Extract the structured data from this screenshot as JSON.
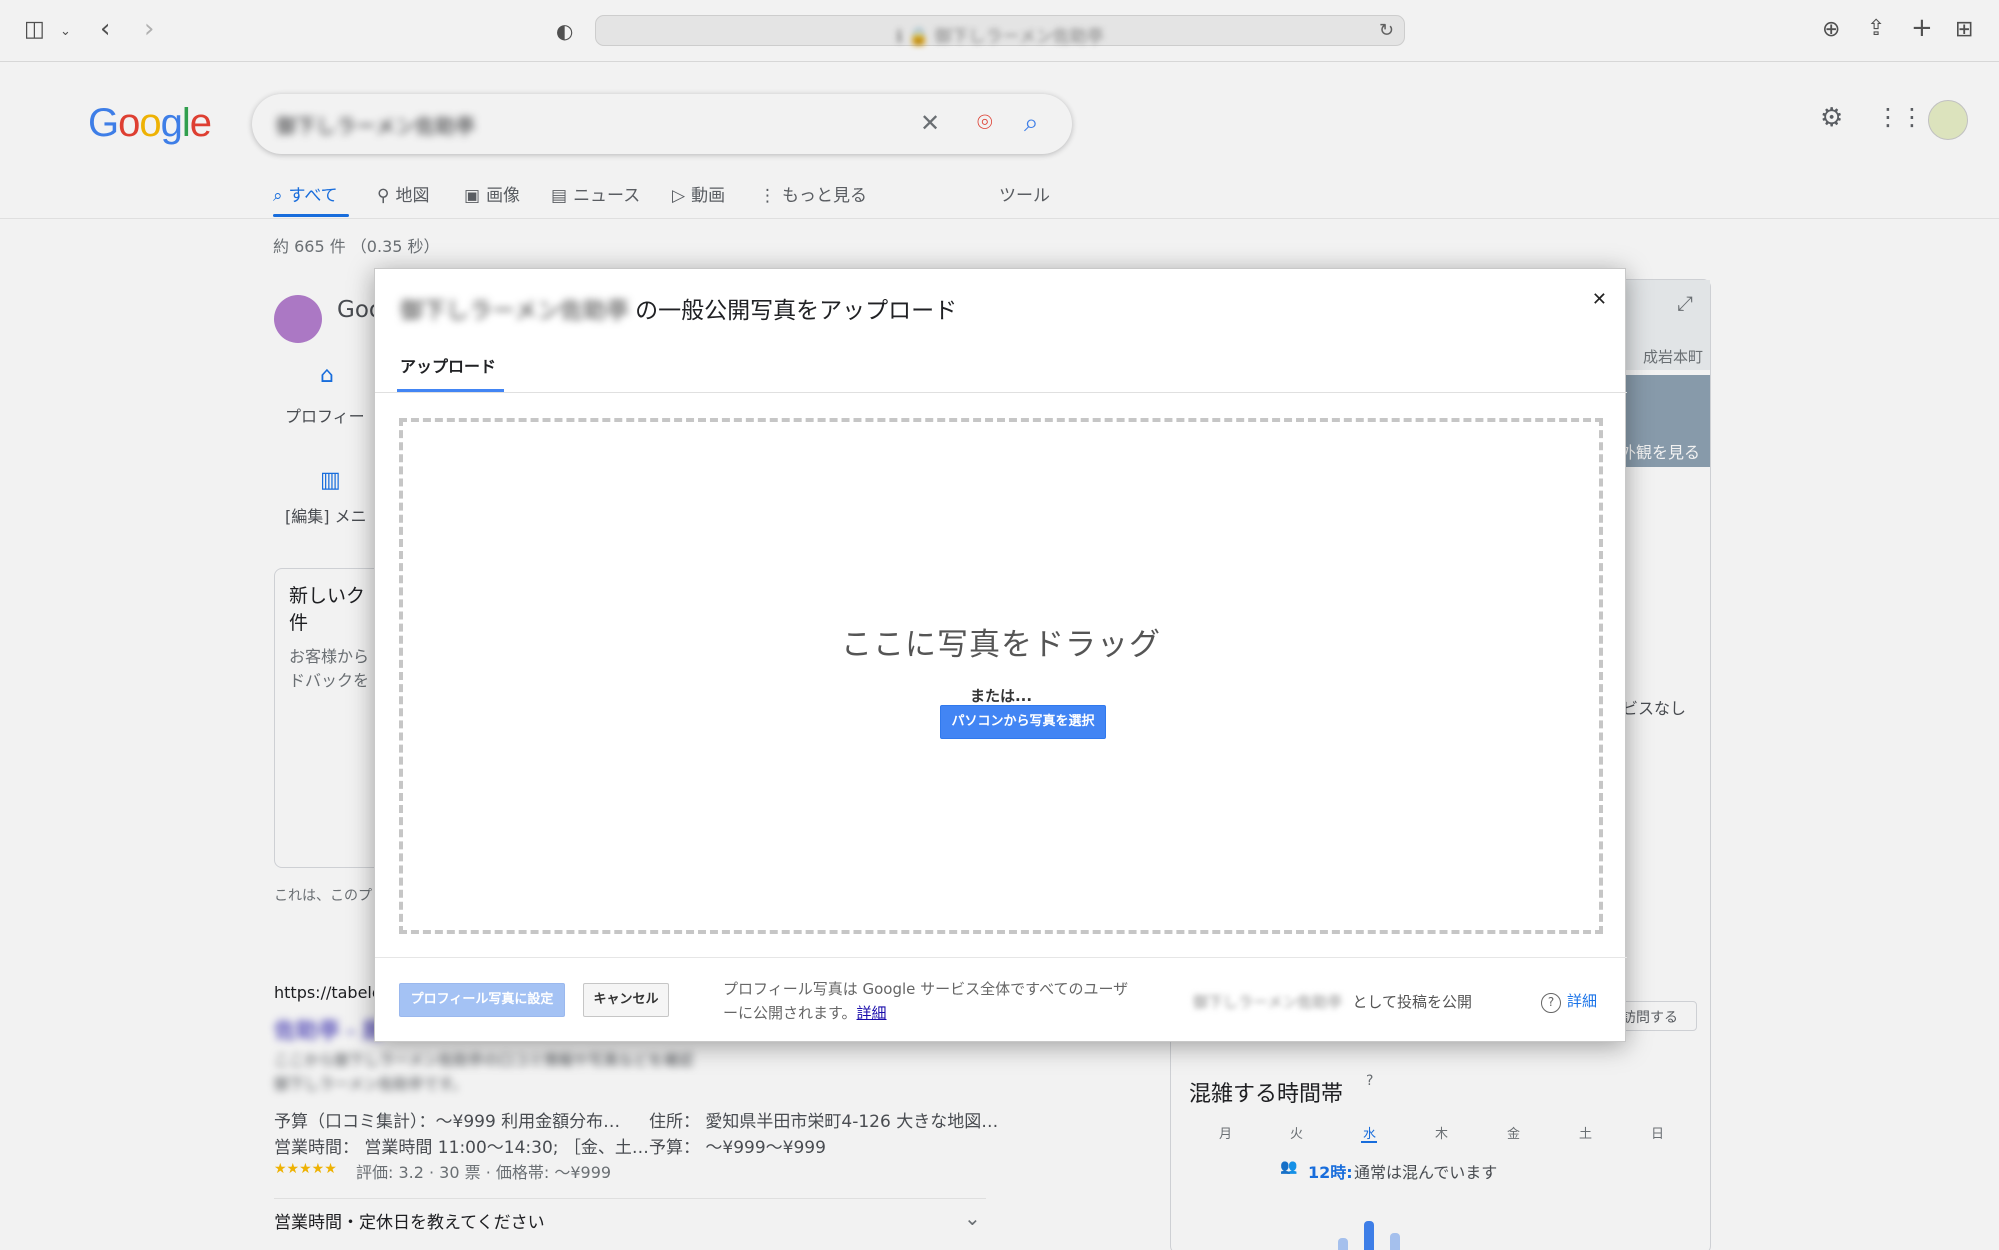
{
  "browser": {
    "url": "ℹ︎ 🔒 御下しラーメン佐助亭",
    "icons": [
      "sidebar-icon",
      "chevron-down-icon",
      "back-icon",
      "forward-icon",
      "shield-icon",
      "reload-icon",
      "download-icon",
      "share-icon",
      "plus-icon",
      "tabs-grid-icon"
    ]
  },
  "google": {
    "logo": [
      "G",
      "o",
      "o",
      "g",
      "l",
      "e"
    ],
    "logo_colors": [
      "#4285f4",
      "#ea4335",
      "#fbbc05",
      "#4285f4",
      "#34a853",
      "#ea4335"
    ],
    "query": "御下しラーメン佐助亭",
    "tabs": [
      {
        "label": "すべて",
        "icon": "search-icon"
      },
      {
        "label": "地図",
        "icon": "map-pin-icon"
      },
      {
        "label": "画像",
        "icon": "image-icon"
      },
      {
        "label": "ニュース",
        "icon": "news-icon"
      },
      {
        "label": "動画",
        "icon": "video-icon"
      },
      {
        "label": "もっと見る",
        "icon": "more-vert-icon"
      },
      {
        "label": "ツール",
        "icon": ""
      }
    ],
    "result_stats": "約 665 件 （0.35 秒）"
  },
  "background": {
    "goo": "Goo",
    "profile": "プロフィー",
    "menu_edit": "[編集] メニ",
    "new_card_1": "新しいク",
    "new_card_2": "件",
    "customer_1": "お客様から",
    "customer_2": "ドバックを",
    "this_is": "これは、このプ",
    "tabelog_url": "https://tabelog",
    "budget_line": "予算（口コミ集計）：～¥999 利用金額分布…",
    "address_line": "住所： 愛知県半田市栄町4-126 大きな地図…",
    "hours_line": "営業時間： 営業時間 11:00～14:30; ［金、土…",
    "budget2_line": "予算： ～¥999～¥999",
    "rating_line": "評価: 3.2 · 30 票 · 価格帯: ～¥999",
    "stars": "★★★★★",
    "hours_ask": "営業時間・定休日を教えてください",
    "map_label": "成岩本町",
    "exterior": "外観を見る",
    "service_none": "ビスなし",
    "visit": "訪問する",
    "busy_title": "混雑する時間帯",
    "days": [
      "月",
      "火",
      "水",
      "木",
      "金",
      "土",
      "日"
    ],
    "busy_now": "12時:",
    "busy_text": "通常は混んでいます"
  },
  "modal": {
    "place_name": "御下しラーメン佐助亭",
    "title_suffix": "の一般公開写真をアップロード",
    "tab_upload": "アップロード",
    "drop_title": "ここに写真をドラッグ",
    "drop_or": "または...",
    "choose_btn": "パソコンから写真を選択",
    "profile_btn": "プロフィール写真に設定",
    "cancel_btn": "キャンセル",
    "foot_note": "プロフィール写真は Google サービス全体ですべてのユーザーに公開されます。",
    "foot_link": "詳細",
    "post_as_name": "御下しラーメン佐助亭",
    "post_as_text": "として投稿を公開",
    "help_label": "詳細"
  }
}
